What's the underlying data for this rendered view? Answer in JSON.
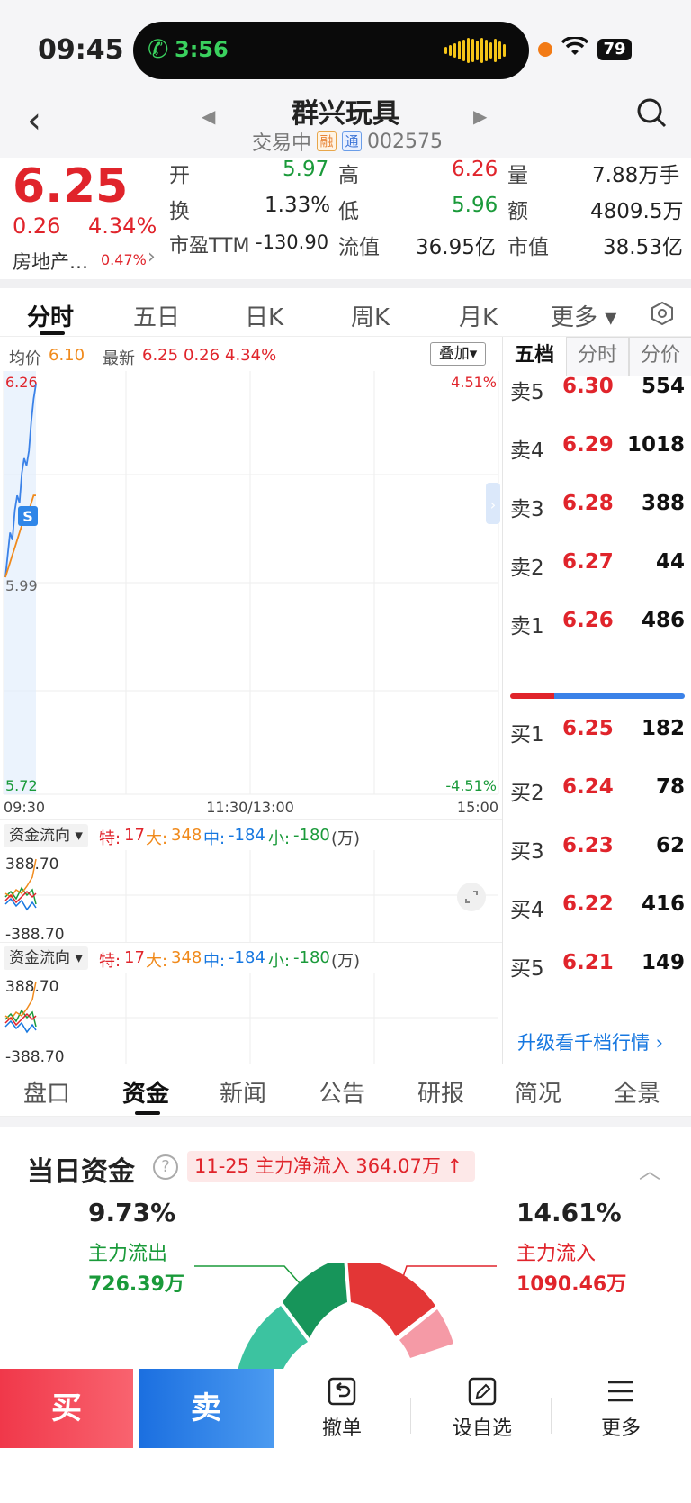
{
  "status_bar": {
    "time": "09:45",
    "call_time": "3:56",
    "battery": "79"
  },
  "header": {
    "stock_name": "群兴玩具",
    "trading_status": "交易中",
    "tag_rong": "融",
    "tag_tong": "通",
    "code": "002575"
  },
  "quote": {
    "price": "6.25",
    "change": "0.26",
    "change_pct": "4.34%",
    "sector": "房地产…",
    "sector_pct": "0.47%",
    "open_label": "开",
    "open": "5.97",
    "high_label": "高",
    "high": "6.26",
    "volume_label": "量",
    "volume": "7.88万手",
    "turnover_label": "换",
    "turnover": "1.33%",
    "low_label": "低",
    "low": "5.96",
    "amount_label": "额",
    "amount": "4809.5万",
    "pe_label": "市盈TTM",
    "pe": "-130.90",
    "float_cap_label": "流值",
    "float_cap": "36.95亿",
    "market_cap_label": "市值",
    "market_cap": "38.53亿"
  },
  "chart_tabs": [
    "分时",
    "五日",
    "日K",
    "周K",
    "月K",
    "更多 ▾"
  ],
  "chart_info": {
    "avg_label": "均价",
    "avg": "6.10",
    "latest_label": "最新",
    "latest": "6.25",
    "latest_chg": "0.26",
    "latest_pct": "4.34%",
    "overlay": "叠加▾"
  },
  "chart_data": {
    "type": "line",
    "y_left_top": "6.26",
    "y_left_mid": "5.99",
    "y_left_bottom": "5.72",
    "y_right_top": "4.51%",
    "y_right_bottom": "-4.51%",
    "x_labels": [
      "09:30",
      "11:30/13:00",
      "15:00"
    ],
    "ylim": [
      5.72,
      6.26
    ],
    "series": [
      {
        "name": "最新",
        "color": "#3b82e8",
        "values": [
          5.99,
          6.02,
          6.05,
          6.04,
          6.08,
          6.1,
          6.09,
          6.13,
          6.15,
          6.14,
          6.16,
          6.2,
          6.23,
          6.25
        ]
      },
      {
        "name": "均价",
        "color": "#f08a1c",
        "values": [
          5.99,
          6.0,
          6.01,
          6.02,
          6.03,
          6.04,
          6.05,
          6.06,
          6.07,
          6.08,
          6.08,
          6.09,
          6.1,
          6.1
        ]
      }
    ],
    "marker": "S"
  },
  "flow": {
    "select_label": "资金流向 ▾",
    "te_label": "特:",
    "te": "17",
    "da_label": "大:",
    "da": "348",
    "zhong_label": "中:",
    "zhong": "-184",
    "xiao_label": "小:",
    "xiao": "-180",
    "unit": "(万)",
    "y_top": "388.70",
    "y_bottom": "-388.70"
  },
  "order_book": {
    "tabs": [
      "五档",
      "分时",
      "分价"
    ],
    "asks": [
      {
        "label": "卖5",
        "price": "6.30",
        "vol": "554"
      },
      {
        "label": "卖4",
        "price": "6.29",
        "vol": "1018"
      },
      {
        "label": "卖3",
        "price": "6.28",
        "vol": "388"
      },
      {
        "label": "卖2",
        "price": "6.27",
        "vol": "44"
      },
      {
        "label": "卖1",
        "price": "6.26",
        "vol": "486"
      }
    ],
    "bids": [
      {
        "label": "买1",
        "price": "6.25",
        "vol": "182"
      },
      {
        "label": "买2",
        "price": "6.24",
        "vol": "78"
      },
      {
        "label": "买3",
        "price": "6.23",
        "vol": "62"
      },
      {
        "label": "买4",
        "price": "6.22",
        "vol": "416"
      },
      {
        "label": "买5",
        "price": "6.21",
        "vol": "149"
      }
    ],
    "buy_ratio": 0.25,
    "upgrade": "升级看千档行情 ›"
  },
  "section_tabs": [
    "盘口",
    "资金",
    "新闻",
    "公告",
    "研报",
    "简况",
    "全景"
  ],
  "fund": {
    "title": "当日资金",
    "badge": "11-25 主力净流入 364.07万 ↑",
    "out_pct": "9.73%",
    "out_label": "主力流出",
    "out_amount": "726.39万",
    "in_pct": "14.61%",
    "in_label": "主力流入",
    "in_amount": "1090.46万"
  },
  "bottom_bar": {
    "buy": "买",
    "sell": "卖",
    "cancel": "撤单",
    "watchlist": "设自选",
    "more": "更多"
  }
}
